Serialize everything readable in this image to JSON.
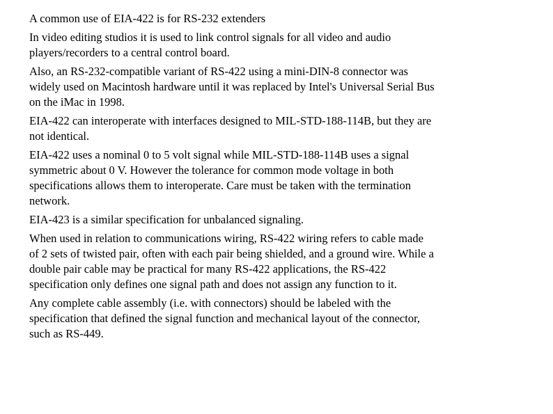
{
  "document": {
    "paragraphs": [
      "A common use of EIA-422 is for RS-232 extenders",
      "In video editing studios it is used to link control signals for all video and audio\nplayers/recorders to a central control board.",
      "Also, an RS-232-compatible variant of RS-422 using a mini-DIN-8 connector was\nwidely used on Macintosh hardware until it was replaced by Intel's Universal Serial Bus\non the iMac in 1998.",
      "EIA-422 can interoperate with interfaces designed to MIL-STD-188-114B, but they are\nnot identical.",
      "EIA-422 uses a nominal 0 to 5 volt signal while MIL-STD-188-114B uses a signal\nsymmetric about 0 V. However the tolerance for common mode voltage in both\nspecifications allows them to interoperate. Care must be taken with the termination\nnetwork.",
      "EIA-423 is a similar specification for unbalanced signaling.",
      "When used in relation to communications wiring, RS-422 wiring refers to cable made\nof 2 sets of twisted pair, often with each pair being shielded, and a ground wire. While a\ndouble pair cable may be practical for many RS-422 applications, the RS-422\nspecification only defines one signal path and does not assign any function to it.",
      "Any complete cable assembly (i.e. with connectors) should be labeled with the\nspecification that defined the signal function and mechanical layout of the connector,\nsuch as RS-449."
    ]
  }
}
